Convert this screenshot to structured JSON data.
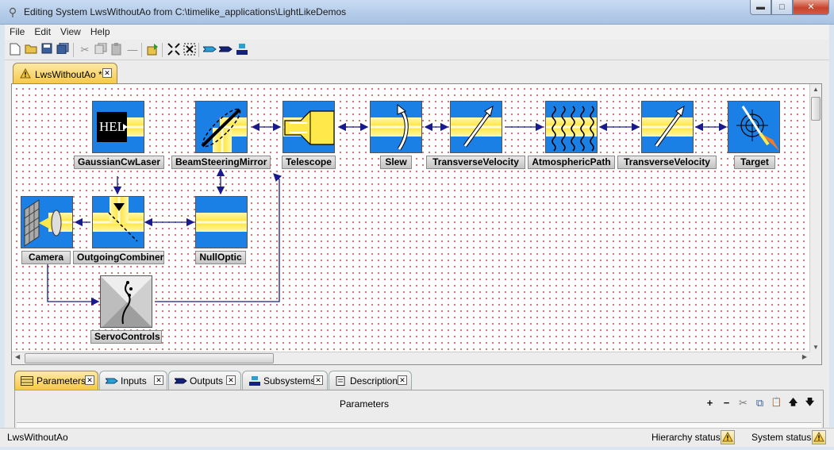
{
  "window": {
    "title": "Editing System LwsWithoutAo from C:\\timelike_applications\\LightLikeDemos",
    "min_glyph": "▬",
    "max_glyph": "□",
    "close_glyph": "✕"
  },
  "menu": [
    "File",
    "Edit",
    "View",
    "Help"
  ],
  "document_tab": {
    "label": "LwsWithoutAo *",
    "close_glyph": "✕"
  },
  "blocks": {
    "gaussian": "GaussianCwLaser",
    "gaussian_text": "HEL",
    "bsm": "BeamSteeringMirror",
    "telescope": "Telescope",
    "slew": "Slew",
    "tv1": "TransverseVelocity",
    "atm": "AtmosphericPath",
    "tv2": "TransverseVelocity",
    "target": "Target",
    "camera": "Camera",
    "combiner": "OutgoingCombiner",
    "nulloptic": "NullOptic",
    "servo": "ServoControls"
  },
  "panel_tabs": [
    {
      "label": "Parameters",
      "icon": "table-icon"
    },
    {
      "label": "Inputs",
      "icon": "input-arrow-icon"
    },
    {
      "label": "Outputs",
      "icon": "output-arrow-icon"
    },
    {
      "label": "Subsystems",
      "icon": "subsystem-icon"
    },
    {
      "label": "Description",
      "icon": "description-icon"
    }
  ],
  "params": {
    "title": "Parameters",
    "tools": [
      "+",
      "−",
      "✂",
      "⧉",
      "📋",
      "🡅",
      "🡇"
    ]
  },
  "status": {
    "left": "LwsWithoutAo",
    "hierarchy_label": "Hierarchy status:",
    "system_label": "System status:"
  },
  "colors": {
    "accent": "#1a80e6",
    "beam": "#ffe84a",
    "connector": "#1a1a8c",
    "grid_dot": "#c84646"
  }
}
